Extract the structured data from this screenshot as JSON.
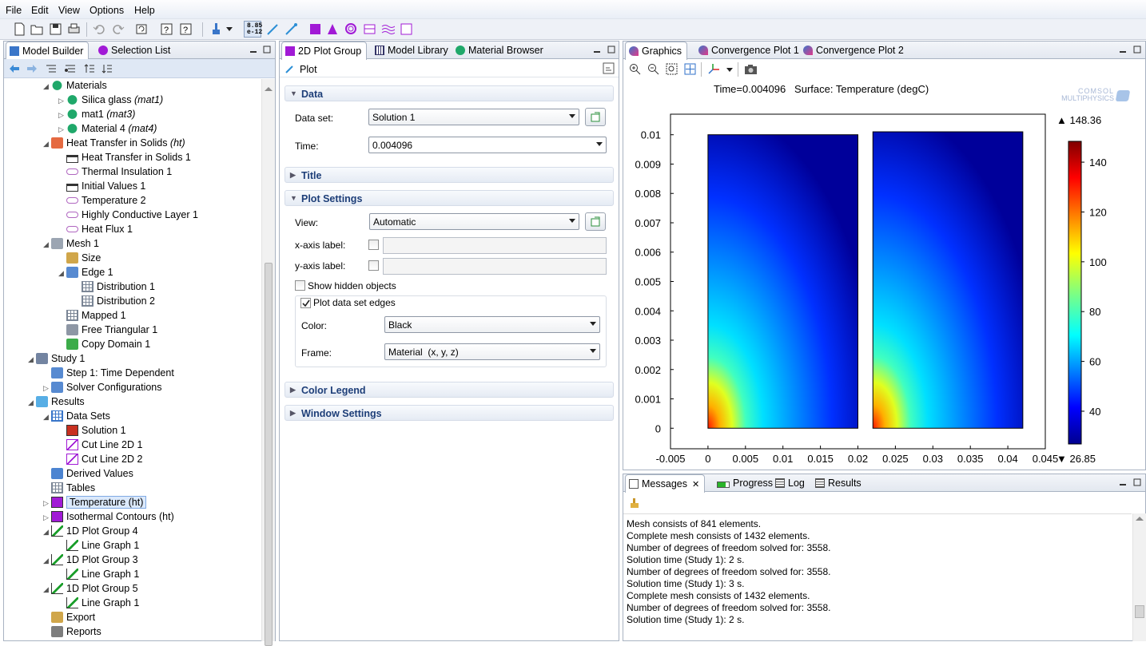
{
  "menu": [
    "File",
    "Edit",
    "View",
    "Options",
    "Help"
  ],
  "toolbar": {
    "icons": [
      "new-icon",
      "open-icon",
      "save-icon",
      "print-icon",
      "undo-icon",
      "redo-icon",
      "rebuild-icon",
      "help-icon",
      "dynamic-help-icon",
      "paintbrush-icon",
      "number-format-icon",
      "probe-icon",
      "arrow-icon",
      "surface-plot-icon",
      "contour-plot-icon",
      "isosurface-plot-icon",
      "slice-plot-icon",
      "streamline-plot-icon",
      "blank-plot-icon"
    ],
    "number_format_label": "8.85\ne-12"
  },
  "model_builder": {
    "tabs": [
      "Model Builder",
      "Selection List"
    ],
    "tree": [
      {
        "label": "Materials",
        "tag": "",
        "indent": 1,
        "arrow": "open",
        "icon": "materials-icon"
      },
      {
        "label": "Silica glass ",
        "tag": "(mat1)",
        "indent": 2,
        "arrow": "closed",
        "icon": "material-icon"
      },
      {
        "label": "mat1 ",
        "tag": "(mat3)",
        "indent": 2,
        "arrow": "closed",
        "icon": "material-icon"
      },
      {
        "label": "Material 4 ",
        "tag": "(mat4)",
        "indent": 2,
        "arrow": "closed",
        "icon": "material-icon"
      },
      {
        "label": "Heat Transfer in Solids ",
        "tag": "(ht)",
        "indent": 1,
        "arrow": "open",
        "icon": "heat-transfer-icon"
      },
      {
        "label": "Heat Transfer in Solids 1",
        "tag": "",
        "indent": 2,
        "arrow": "",
        "icon": "domain-feature-icon"
      },
      {
        "label": "Thermal Insulation 1",
        "tag": "",
        "indent": 2,
        "arrow": "",
        "icon": "boundary-feature-icon"
      },
      {
        "label": "Initial Values 1",
        "tag": "",
        "indent": 2,
        "arrow": "",
        "icon": "domain-feature-icon"
      },
      {
        "label": "Temperature 2",
        "tag": "",
        "indent": 2,
        "arrow": "",
        "icon": "boundary-feature-icon"
      },
      {
        "label": "Highly Conductive Layer 1",
        "tag": "",
        "indent": 2,
        "arrow": "",
        "icon": "boundary-feature-icon"
      },
      {
        "label": "Heat Flux 1",
        "tag": "",
        "indent": 2,
        "arrow": "",
        "icon": "boundary-feature-icon"
      },
      {
        "label": "Mesh 1",
        "tag": "",
        "indent": 1,
        "arrow": "open",
        "icon": "mesh-icon"
      },
      {
        "label": "Size",
        "tag": "",
        "indent": 2,
        "arrow": "",
        "icon": "size-icon"
      },
      {
        "label": "Edge 1",
        "tag": "",
        "indent": 2,
        "arrow": "open",
        "icon": "edge-icon"
      },
      {
        "label": "Distribution 1",
        "tag": "",
        "indent": 3,
        "arrow": "",
        "icon": "distribution-icon"
      },
      {
        "label": "Distribution 2",
        "tag": "",
        "indent": 3,
        "arrow": "",
        "icon": "distribution-icon"
      },
      {
        "label": "Mapped 1",
        "tag": "",
        "indent": 2,
        "arrow": "",
        "icon": "mapped-mesh-icon"
      },
      {
        "label": "Free Triangular 1",
        "tag": "",
        "indent": 2,
        "arrow": "",
        "icon": "triangular-mesh-icon"
      },
      {
        "label": "Copy Domain 1",
        "tag": "",
        "indent": 2,
        "arrow": "",
        "icon": "copy-domain-icon"
      },
      {
        "label": "Study 1",
        "tag": "",
        "indent": 0,
        "arrow": "open",
        "icon": "study-icon"
      },
      {
        "label": "Step 1: Time Dependent",
        "tag": "",
        "indent": 1,
        "arrow": "",
        "icon": "time-dependent-icon"
      },
      {
        "label": "Solver Configurations",
        "tag": "",
        "indent": 1,
        "arrow": "closed",
        "icon": "solver-icon"
      },
      {
        "label": "Results",
        "tag": "",
        "indent": 0,
        "arrow": "open",
        "icon": "results-icon"
      },
      {
        "label": "Data Sets",
        "tag": "",
        "indent": 1,
        "arrow": "open",
        "icon": "data-sets-icon"
      },
      {
        "label": "Solution 1",
        "tag": "",
        "indent": 2,
        "arrow": "",
        "icon": "solution-icon"
      },
      {
        "label": "Cut Line 2D 1",
        "tag": "",
        "indent": 2,
        "arrow": "",
        "icon": "cut-line-icon"
      },
      {
        "label": "Cut Line 2D 2",
        "tag": "",
        "indent": 2,
        "arrow": "",
        "icon": "cut-line-icon"
      },
      {
        "label": "Derived Values",
        "tag": "",
        "indent": 1,
        "arrow": "",
        "icon": "derived-values-icon"
      },
      {
        "label": "Tables",
        "tag": "",
        "indent": 1,
        "arrow": "",
        "icon": "tables-icon"
      },
      {
        "label": "Temperature (ht)",
        "tag": "",
        "indent": 1,
        "arrow": "closed",
        "icon": "surface-plot-group-icon",
        "selected": true
      },
      {
        "label": "Isothermal Contours (ht)",
        "tag": "",
        "indent": 1,
        "arrow": "closed",
        "icon": "contour-plot-group-icon"
      },
      {
        "label": "1D Plot Group 4",
        "tag": "",
        "indent": 1,
        "arrow": "open",
        "icon": "plot-group-1d-icon"
      },
      {
        "label": "Line Graph 1",
        "tag": "",
        "indent": 2,
        "arrow": "",
        "icon": "line-graph-icon"
      },
      {
        "label": "1D Plot Group 3",
        "tag": "",
        "indent": 1,
        "arrow": "open",
        "icon": "plot-group-1d-icon"
      },
      {
        "label": "Line Graph 1",
        "tag": "",
        "indent": 2,
        "arrow": "",
        "icon": "line-graph-icon"
      },
      {
        "label": "1D Plot Group 5",
        "tag": "",
        "indent": 1,
        "arrow": "open",
        "icon": "plot-group-1d-icon"
      },
      {
        "label": "Line Graph 1",
        "tag": "",
        "indent": 2,
        "arrow": "",
        "icon": "line-graph-icon"
      },
      {
        "label": "Export",
        "tag": "",
        "indent": 1,
        "arrow": "",
        "icon": "export-icon"
      },
      {
        "label": "Reports",
        "tag": "",
        "indent": 1,
        "arrow": "",
        "icon": "reports-icon"
      }
    ]
  },
  "settings": {
    "tabs": [
      "2D Plot Group",
      "Model Library",
      "Material Browser"
    ],
    "header": "Plot",
    "sections": {
      "data": "Data",
      "title": "Title",
      "plot_settings": "Plot Settings",
      "color_legend": "Color Legend",
      "window_settings": "Window Settings"
    },
    "data_set_label": "Data set:",
    "data_set_value": "Solution 1",
    "time_label": "Time:",
    "time_value": "0.004096",
    "view_label": "View:",
    "view_value": "Automatic",
    "xaxis_label": "x-axis label:",
    "yaxis_label": "y-axis label:",
    "show_hidden": "Show hidden objects",
    "plot_edges": "Plot data set edges",
    "color_label": "Color:",
    "color_value": "Black",
    "frame_label": "Frame:",
    "frame_value": "Material  (x, y, z)"
  },
  "graphics": {
    "tabs": [
      "Graphics",
      "Convergence Plot 1",
      "Convergence Plot 2"
    ],
    "plot_title": "Time=0.004096   Surface: Temperature (degC)",
    "logo_line1": "COMSOL",
    "logo_line2": "MULTIPHYSICS"
  },
  "chart_data": {
    "type": "heatmap",
    "title": "Time=0.004096   Surface: Temperature (degC)",
    "xlabel": "",
    "ylabel": "",
    "xlim": [
      -0.005,
      0.045
    ],
    "ylim": [
      -0.0007,
      0.0107
    ],
    "x_ticks": [
      "-0.005",
      "0",
      "0.005",
      "0.01",
      "0.015",
      "0.02",
      "0.025",
      "0.03",
      "0.035",
      "0.04",
      "0.045"
    ],
    "y_ticks": [
      "0",
      "0.001",
      "0.002",
      "0.003",
      "0.004",
      "0.005",
      "0.006",
      "0.007",
      "0.008",
      "0.009",
      "0.01"
    ],
    "domains": [
      {
        "x": [
          0,
          0.02
        ],
        "y": [
          0,
          0.01
        ]
      },
      {
        "x": [
          0.022,
          0.042
        ],
        "y": [
          0,
          0.0101
        ]
      }
    ],
    "colorbar": {
      "min": 26.85,
      "max": 148.36,
      "min_label": "▼ 26.85",
      "max_label": "▲ 148.36",
      "ticks": [
        "140",
        "120",
        "100",
        "80",
        "60",
        "40"
      ],
      "tick_values": [
        140,
        120,
        100,
        80,
        60,
        40
      ],
      "colormap": "rainbow"
    }
  },
  "messages": {
    "tabs": [
      "Messages",
      "Progress",
      "Log",
      "Results"
    ],
    "lines": [
      "Mesh consists of 841 elements.",
      "Complete mesh consists of 1432 elements.",
      "Number of degrees of freedom solved for: 3558.",
      "Solution time (Study 1): 2 s.",
      "Number of degrees of freedom solved for: 3558.",
      "Solution time (Study 1): 3 s.",
      "Complete mesh consists of 1432 elements.",
      "Number of degrees of freedom solved for: 3558.",
      "Solution time (Study 1): 2 s."
    ]
  }
}
